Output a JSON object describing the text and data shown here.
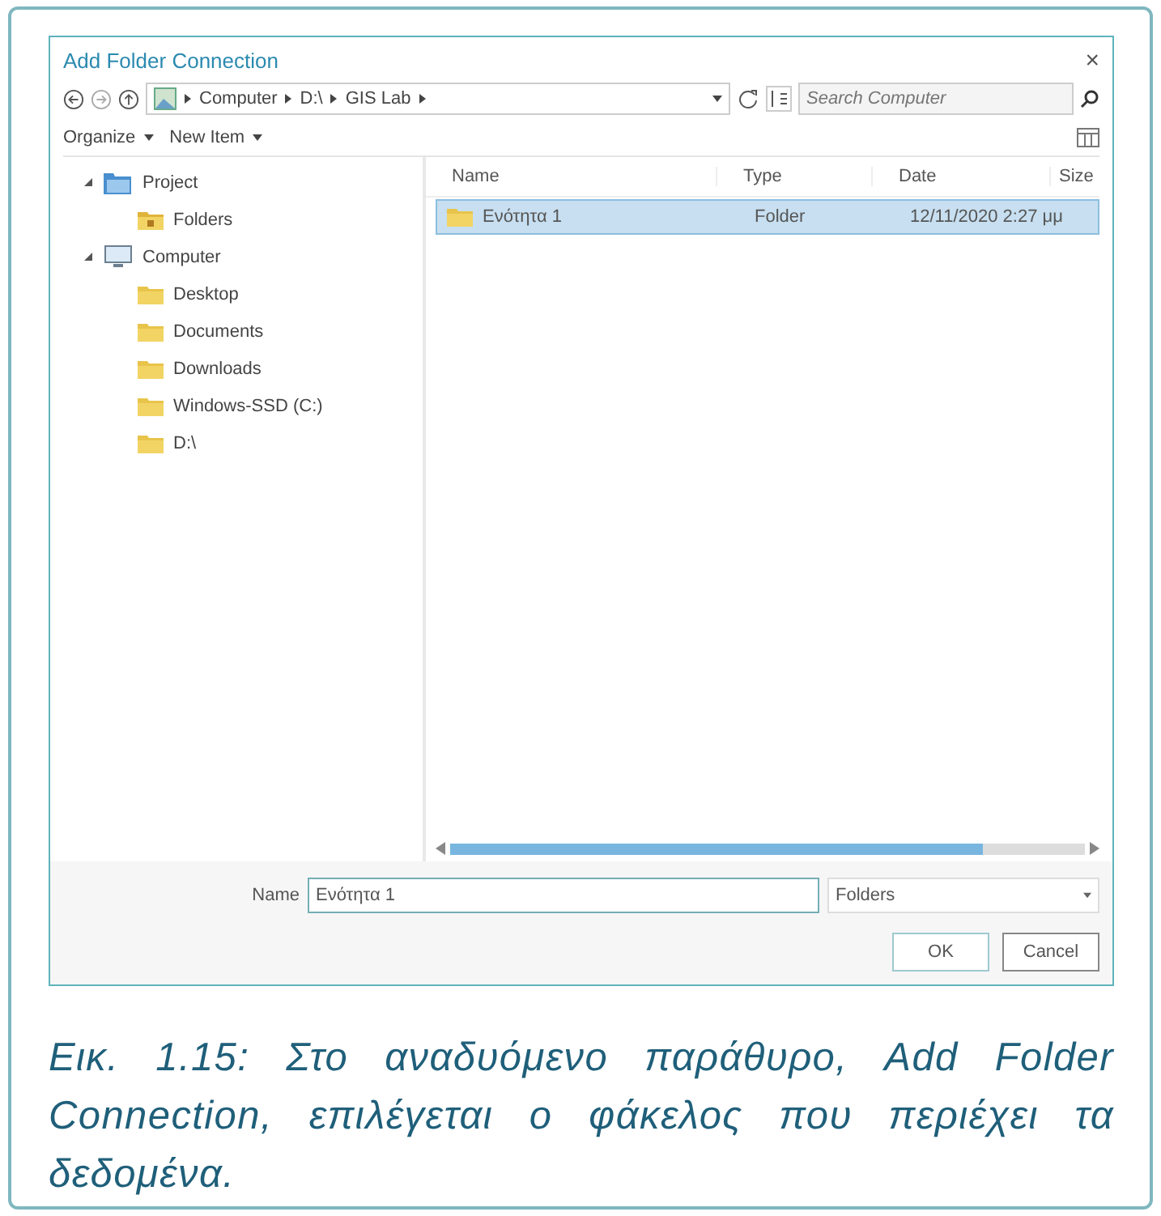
{
  "window": {
    "title": "Add Folder Connection",
    "close": "×"
  },
  "address": {
    "breadcrumbs": [
      "Computer",
      "D:\\",
      "GIS Lab"
    ],
    "search": {
      "placeholder": "Search Computer"
    }
  },
  "toolbar": [
    "Organize",
    "New Item"
  ],
  "tree": [
    {
      "label": "Project",
      "kind": "project",
      "expanded": true,
      "children": [
        {
          "label": "Folders",
          "kind": "special-folder"
        }
      ]
    },
    {
      "label": "Computer",
      "kind": "computer",
      "expanded": true,
      "children": [
        {
          "label": "Desktop",
          "kind": "folder"
        },
        {
          "label": "Documents",
          "kind": "folder"
        },
        {
          "label": "Downloads",
          "kind": "folder"
        },
        {
          "label": "Windows-SSD (C:)",
          "kind": "folder"
        },
        {
          "label": "D:\\",
          "kind": "folder"
        }
      ]
    }
  ],
  "table": {
    "columns": [
      "Name",
      "Type",
      "Date",
      "Size"
    ],
    "rows": [
      {
        "name": "Ενότητα 1",
        "type": "Folder",
        "date": "12/11/2020 2:27 μμ",
        "selected": true
      }
    ]
  },
  "name_field": {
    "label": "Name",
    "value": "Ενότητα 1"
  },
  "filter": "Folders",
  "buttons": [
    "OK",
    "Cancel"
  ],
  "caption": "Εικ. 1.15: Στο αναδυόμενο παράθυρο, Add Folder Connection, επιλέγεται ο φάκελος που περιέχει τα δεδομένα."
}
